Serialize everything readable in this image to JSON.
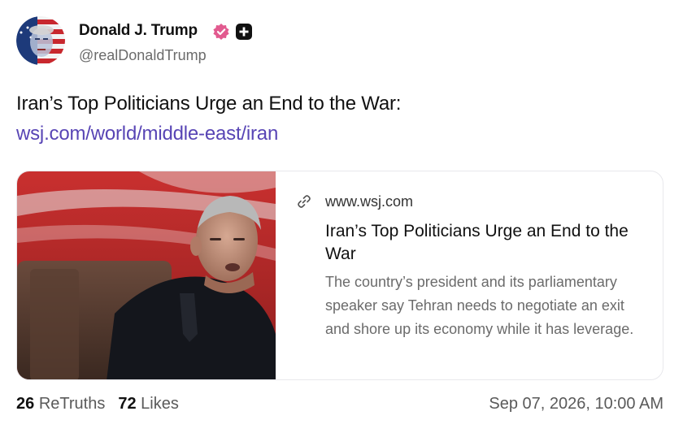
{
  "author": {
    "display_name": "Donald J. Trump",
    "handle": "@realDonaldTrump",
    "verified_color": "#e25a8f"
  },
  "post": {
    "text": "Iran’s Top Politicians Urge an End to the War:",
    "link_text": "wsj.com/world/middle-east/iran",
    "link_color": "#5845b5"
  },
  "card": {
    "domain": "www.wsj.com",
    "title": "Iran’s Top Politicians Urge an End to the War",
    "description": "The country’s president and its parliamentary speaker say Tehran needs to negotiate an exit and shore up its economy while it has leverage."
  },
  "stats": {
    "retruths_count": "26",
    "retruths_label": "ReTruths",
    "likes_count": "72",
    "likes_label": "Likes"
  },
  "timestamp": "Sep 07, 2026, 10:00 AM"
}
